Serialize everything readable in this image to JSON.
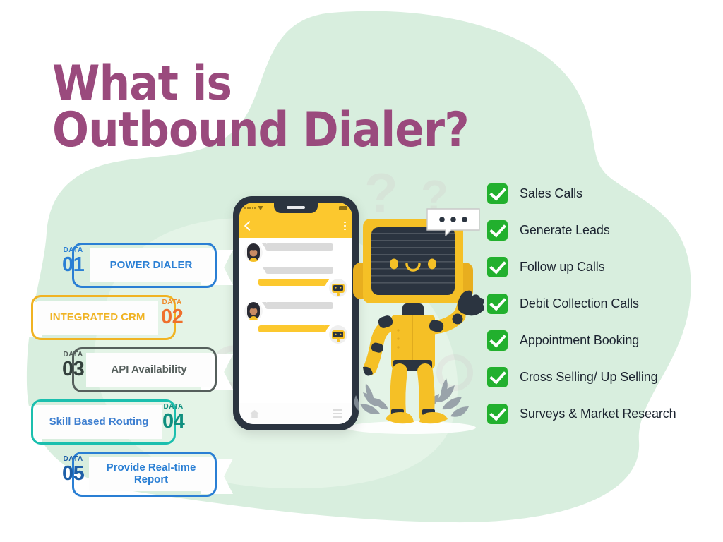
{
  "title": {
    "line1": "What is",
    "line2": "Outbound Dialer?",
    "color": "#9a4a7d"
  },
  "theme": {
    "background": "#ffffff",
    "blob_outer": "#d8eede",
    "blob_inner": "#e6f4e9",
    "accent_yellow": "#fcc82e",
    "accent_green": "#22b02e",
    "phone_frame": "#2b3440"
  },
  "data_cards": {
    "data_label": "DATA",
    "items": [
      {
        "number": "01",
        "label": "POWER DIALER",
        "color": "#2a7fd4",
        "text_color": "#2a7fd4",
        "num_color": "#2a7fd4",
        "tail": "right"
      },
      {
        "number": "02",
        "label": "INTEGRATED CRM",
        "color": "#f0b323",
        "text_color": "#f0b323",
        "num_color": "#ef6f2c",
        "tail": "left"
      },
      {
        "number": "03",
        "label": "API Availability",
        "color": "#555f5c",
        "text_color": "#555f5c",
        "num_color": "#33403c",
        "tail": "right"
      },
      {
        "number": "04",
        "label": "Skill Based Routing",
        "color": "#1bbfae",
        "text_color": "#3e7fd0",
        "num_color": "#0f8f7f",
        "tail": "left"
      },
      {
        "number": "05",
        "label": "Provide Real-time Report",
        "color": "#2a7fd4",
        "text_color": "#2a7fd4",
        "num_color": "#1e5fa8",
        "tail": "right"
      }
    ]
  },
  "checklist": {
    "items": [
      "Sales Calls",
      "Generate Leads",
      "Follow up Calls",
      "Debit Collection Calls",
      "Appointment Booking",
      "Cross Selling/ Up Selling",
      "Surveys & Market Research"
    ]
  },
  "phone": {
    "app_bar": {
      "back_icon": "chevron-left-icon",
      "menu_icon": "kebab-menu-icon"
    },
    "status": {
      "signal_icon": "signal-dots-icon",
      "wifi_icon": "wifi-icon",
      "battery_icon": "battery-icon"
    },
    "nav": {
      "home_icon": "home-icon",
      "menu_icon": "hamburger-menu-icon"
    },
    "messages": [
      {
        "side": "in",
        "avatar": "woman-avatar",
        "lines": 4
      },
      {
        "side": "in",
        "avatar": "none",
        "lines": 3
      },
      {
        "side": "out",
        "avatar": "robot-avatar",
        "lines": 4
      },
      {
        "side": "in",
        "avatar": "woman-avatar",
        "lines": 3
      },
      {
        "side": "out",
        "avatar": "robot-avatar",
        "lines": 3
      }
    ]
  },
  "robot": {
    "name": "yellow-robot-mascot",
    "speech_bubble_dots": 3,
    "body_color": "#f5c026",
    "screen_color": "#2b3440"
  }
}
